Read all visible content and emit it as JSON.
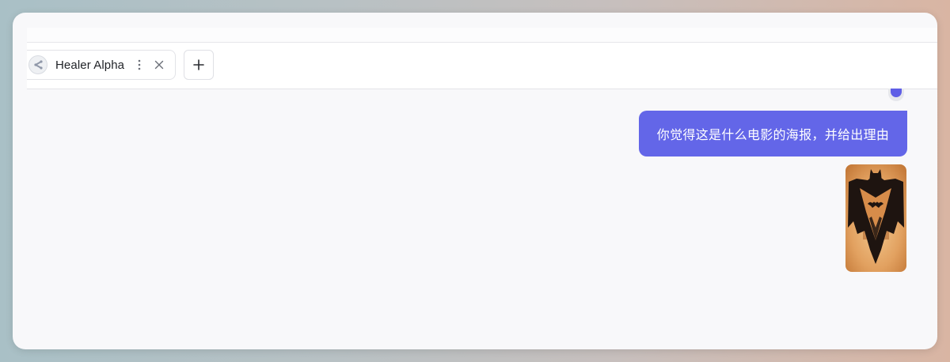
{
  "tabs": [
    {
      "label": "Healer Alpha",
      "icon": "share-icon"
    }
  ],
  "tab_actions": {
    "menu_icon": "more-vertical-icon",
    "close_icon": "close-icon",
    "add_icon": "plus-icon"
  },
  "chat": {
    "messages": [
      {
        "role": "user",
        "text": "你觉得这是什么电影的海报，并给出理由",
        "attachment": "image"
      }
    ]
  },
  "colors": {
    "accent": "#6366e8",
    "window_bg": "#f8f8fa",
    "tab_bg": "#ffffff"
  }
}
